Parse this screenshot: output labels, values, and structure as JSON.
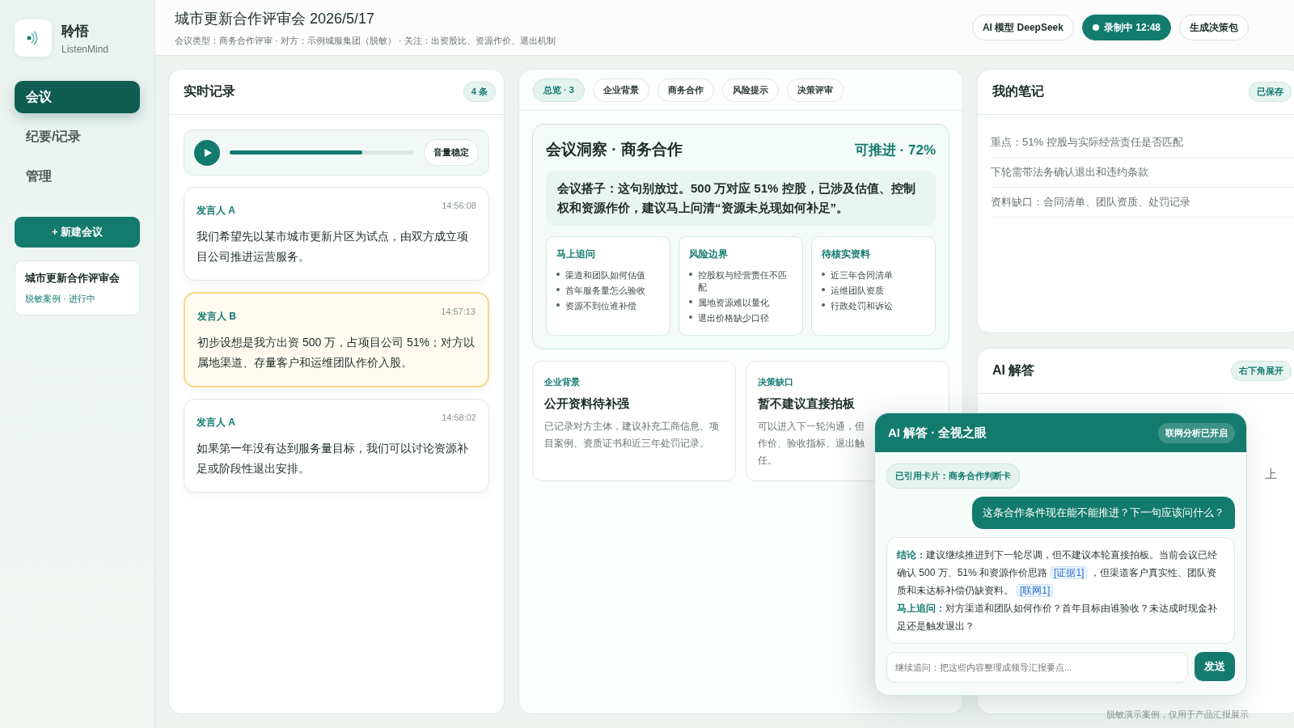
{
  "app": {
    "name": "聆悟",
    "subtitle": "ListenMind"
  },
  "nav": [
    {
      "label": "会议",
      "selected": true
    },
    {
      "label": "纪要/记录",
      "selected": false
    },
    {
      "label": "管理",
      "selected": false
    }
  ],
  "new_meeting_button": "+ 新建会议",
  "meeting_card": {
    "title": "城市更新合作评审会",
    "status": "脱敏案例 · 进行中"
  },
  "header": {
    "title": "城市更新合作评审会 2026/5/17",
    "meta": "会议类型：商务合作评审 · 对方：示例城服集团（脱敏） · 关注：出资股比、资源作价、退出机制",
    "model_button": "AI 模型 DeepSeek",
    "recording_button": "录制中 12:48",
    "generate_button": "生成决策包"
  },
  "transcript": {
    "title": "实时记录",
    "count": "4 条",
    "player": {
      "level": 0.72,
      "status": "音量稳定"
    },
    "entries": [
      {
        "speaker": "发言人 A",
        "time": "14:56:08",
        "text": "我们希望先以某市城市更新片区为试点，由双方成立项目公司推进运营服务。",
        "highlighted": false
      },
      {
        "speaker": "发言人 B",
        "time": "14:57:13",
        "text": "初步设想是我方出资 500 万，占项目公司 51%；对方以属地渠道、存量客户和运维团队作价入股。",
        "highlighted": true
      },
      {
        "speaker": "发言人 A",
        "time": "14:58:02",
        "text": "如果第一年没有达到服务量目标，我们可以讨论资源补足或阶段性退出安排。",
        "highlighted": false
      }
    ]
  },
  "tabs": [
    {
      "label": "总览 · 3",
      "selected": true
    },
    {
      "label": "企业背景",
      "selected": false
    },
    {
      "label": "商务合作",
      "selected": false
    },
    {
      "label": "风险提示",
      "selected": false
    },
    {
      "label": "决策评审",
      "selected": false
    }
  ],
  "insight": {
    "title": "会议洞察 · 商务合作",
    "score": "可推进 · 72%",
    "summary": "会议搭子：这句别放过。500 万对应 51% 控股，已涉及估值、控制权和资源作价，建议马上问清“资源未兑现如何补足”。",
    "columns": [
      {
        "title": "马上追问",
        "items": [
          "渠道和团队如何估值",
          "首年服务量怎么验收",
          "资源不到位谁补偿"
        ]
      },
      {
        "title": "风险边界",
        "items": [
          "控股权与经营责任不匹配",
          "属地资源难以量化",
          "退出价格缺少口径"
        ]
      },
      {
        "title": "待核实资料",
        "items": [
          "近三年合同清单",
          "运维团队资质",
          "行政处罚和诉讼"
        ]
      }
    ]
  },
  "cards": [
    {
      "tag": "企业背景",
      "title": "公开资料待补强",
      "lines": [
        "已记录对方主体，建议补充工商信息、项目案例、资质证书和近三年处罚记录。"
      ]
    },
    {
      "tag": "决策缺口",
      "title": "暂不建议直接拍板",
      "lines": [
        "可以进入下一轮沟通，但",
        "作价、验收指标、退出触",
        "任。"
      ]
    }
  ],
  "notes": {
    "title": "我的笔记",
    "badge": "已保存",
    "items": [
      "重点：51% 控股与实际经营责任是否匹配",
      "下轮需带法务确认退出和违约条款",
      "资料缺口：合同清单、团队资质、处罚记录"
    ]
  },
  "ai_panel": {
    "title": "AI 解答",
    "badge": "右下角展开",
    "fragment": "上"
  },
  "ai_popup": {
    "title": "AI 解答 · 全视之眼",
    "badge": "联网分析已开启",
    "cited": "已引用卡片：商务合作判断卡",
    "question": "这条合作条件现在能不能推进？下一句应该问什么？",
    "answer": [
      {
        "label": "结论：",
        "segments": [
          {
            "kind": "text",
            "text": "建议继续推进到下一轮尽调，但不建议本轮直接拍板。当前会议已经确认 500 万、51% 和资源作价思路"
          },
          {
            "kind": "cite",
            "text": "[证据1]"
          },
          {
            "kind": "text",
            "text": "，但渠道客户真实性、团队资质和未达标补偿仍缺资料。"
          },
          {
            "kind": "cite",
            "text": "[联网1]"
          }
        ]
      },
      {
        "label": "马上追问：",
        "segments": [
          {
            "kind": "text",
            "text": "对方渠道和团队如何作价？首年目标由谁验收？未达成时现金补足还是触发退出？"
          }
        ]
      }
    ],
    "input_placeholder": "继续追问：把这些内容整理成领导汇报要点...",
    "send_button": "发送"
  },
  "footer": "脱敏演示案例，仅用于产品汇报展示"
}
